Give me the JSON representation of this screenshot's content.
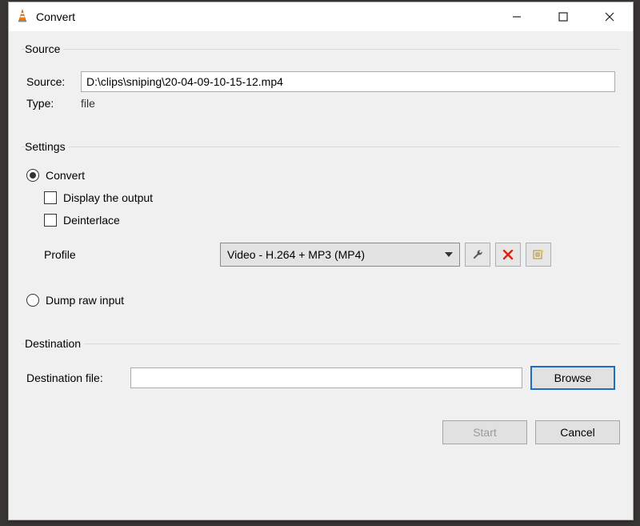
{
  "window": {
    "title": "Convert"
  },
  "source": {
    "legend": "Source",
    "source_label": "Source:",
    "source_value": "D:\\clips\\sniping\\20-04-09-10-15-12.mp4",
    "type_label": "Type:",
    "type_value": "file"
  },
  "settings": {
    "legend": "Settings",
    "convert_label": "Convert",
    "display_output_label": "Display the output",
    "deinterlace_label": "Deinterlace",
    "profile_label": "Profile",
    "profile_value": "Video - H.264 + MP3 (MP4)",
    "dump_raw_label": "Dump raw input"
  },
  "destination": {
    "legend": "Destination",
    "file_label": "Destination file:",
    "file_value": "",
    "browse_label": "Browse"
  },
  "footer": {
    "start_label": "Start",
    "cancel_label": "Cancel"
  }
}
